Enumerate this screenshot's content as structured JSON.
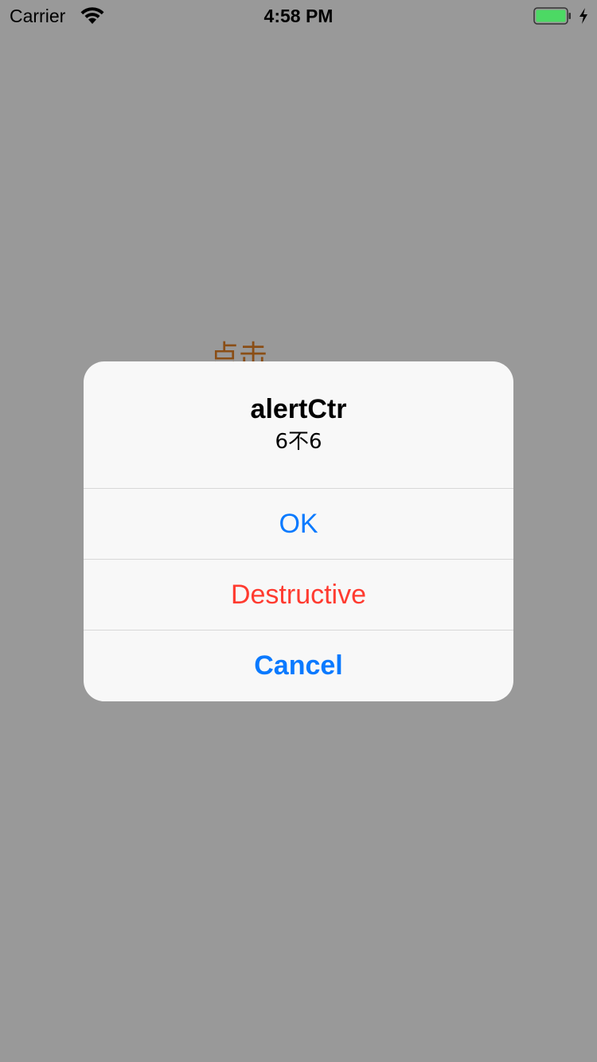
{
  "status_bar": {
    "carrier": "Carrier",
    "time": "4:58 PM",
    "battery_color": "#4cd964"
  },
  "background": {
    "button_label": "点击",
    "button_color": "#8a4e16"
  },
  "alert": {
    "title": "alertCtr",
    "message": "6不6",
    "actions": [
      {
        "label": "OK",
        "style": "default",
        "color": "#0a7aff"
      },
      {
        "label": "Destructive",
        "style": "destructive",
        "color": "#ff3b30"
      },
      {
        "label": "Cancel",
        "style": "cancel",
        "color": "#0a7aff"
      }
    ]
  }
}
